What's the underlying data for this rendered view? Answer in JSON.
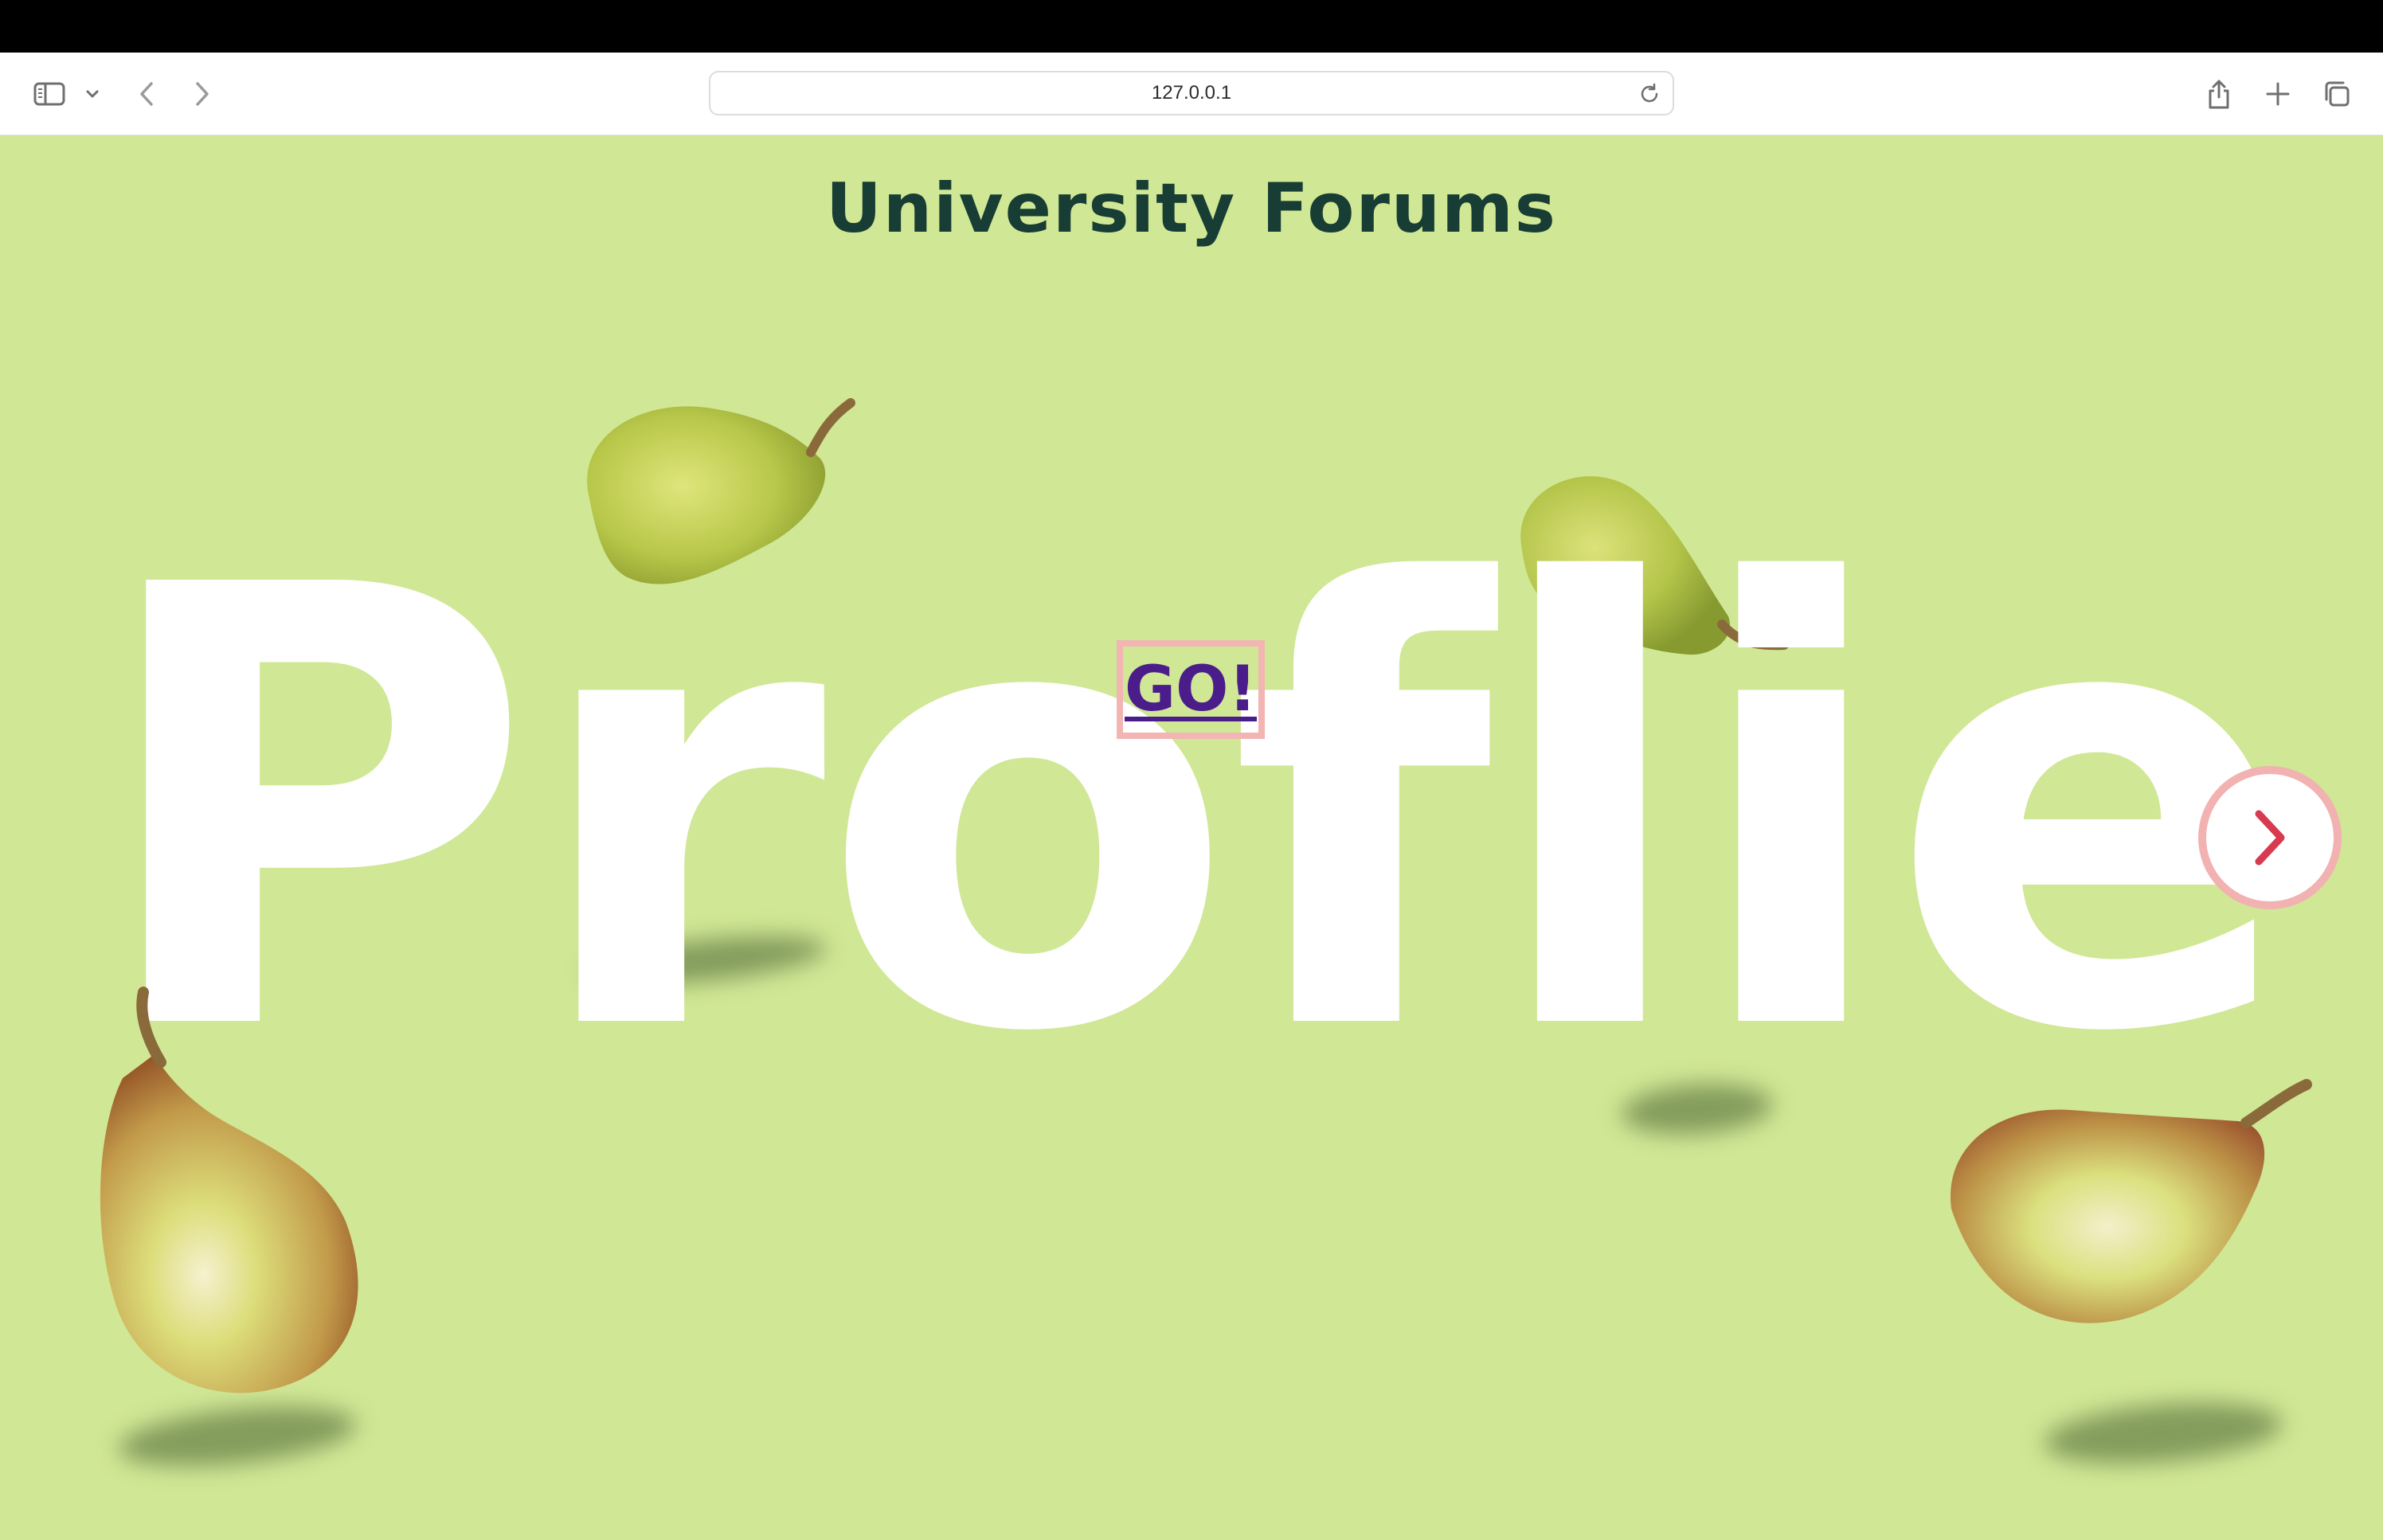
{
  "browser": {
    "url": "127.0.0.1",
    "icons": [
      "sidebar-icon",
      "chevron-down-icon",
      "back-icon",
      "forward-icon",
      "reload-icon",
      "share-icon",
      "new-tab-icon",
      "tabs-overview-icon"
    ]
  },
  "page": {
    "title": "University Forums",
    "hero_word": "Proflie",
    "go_link": "GO!",
    "next_icon": "chevron-right-icon"
  },
  "colors": {
    "background": "#d0e795",
    "title": "#183d34",
    "hero_text": "#ffffff",
    "link": "#4a1d8a",
    "link_border": "#f2b5b3",
    "next_arrow": "#d83a52",
    "next_ring": "#f1b2b1"
  }
}
